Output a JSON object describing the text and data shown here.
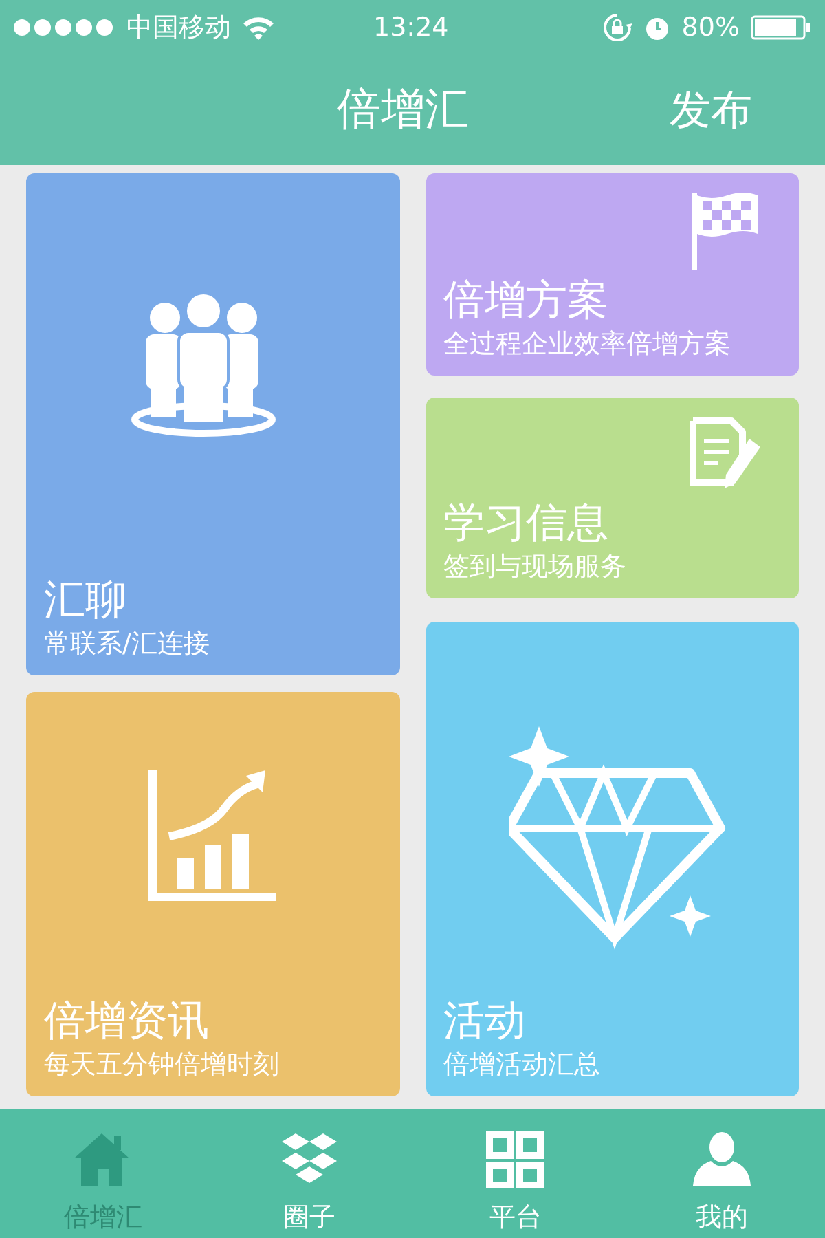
{
  "status_bar": {
    "carrier": "中国移动",
    "time": "13:24",
    "battery": "80%"
  },
  "nav_bar": {
    "title": "倍增汇",
    "action": "发布"
  },
  "left_column": [
    {
      "kind": "people",
      "title": "汇聊",
      "subtitle": "常联系/汇连接",
      "color": "#7aaae8"
    },
    {
      "kind": "chart",
      "title": "倍增资讯",
      "subtitle": "每天五分钟倍增时刻",
      "color": "#ebc16c"
    }
  ],
  "right_column": [
    {
      "kind": "flag",
      "title": "倍增方案",
      "subtitle": "全过程企业效率倍增方案",
      "color": "#bea8f2"
    },
    {
      "kind": "note",
      "title": "学习信息",
      "subtitle": "签到与现场服务",
      "color": "#b9de8e"
    },
    {
      "kind": "diamond",
      "title": "活动",
      "subtitle": "倍增活动汇总",
      "color": "#71cdf0"
    }
  ],
  "tab_bar": [
    {
      "label": "倍增汇",
      "kind": "home",
      "selected": true
    },
    {
      "label": "圈子",
      "kind": "box",
      "selected": false
    },
    {
      "label": "平台",
      "kind": "grid",
      "selected": false
    },
    {
      "label": "我的",
      "kind": "person",
      "selected": false
    }
  ]
}
